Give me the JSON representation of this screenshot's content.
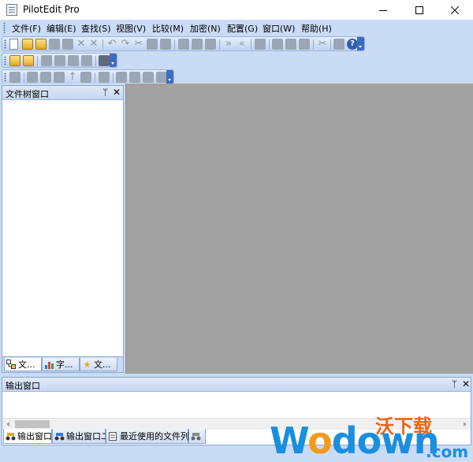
{
  "window": {
    "title": "PilotEdit Pro"
  },
  "menu": [
    "文件(F)",
    "编辑(E)",
    "查找(S)",
    "视图(V)",
    "比较(M)",
    "加密(N)",
    "配置(G)",
    "窗口(W)",
    "帮助(H)"
  ],
  "file_tree_panel": {
    "title": "文件树窗口",
    "pin": "ᛘ",
    "close": "✕",
    "tabs": [
      "文...",
      "字...",
      "文..."
    ]
  },
  "output_panel": {
    "title": "输出窗口",
    "pin": "ᛘ",
    "close": "✕",
    "tabs": [
      "输出窗口",
      "输出窗口二",
      "最近使用的文件列表"
    ]
  },
  "watermark": {
    "cn": "沃下载",
    "logo_w": "W",
    "logo_o": "o",
    "logo_rest": "down",
    "logo_com": ".com"
  },
  "colors": {
    "chrome": "#c9dbf5",
    "mdi_background": "#a2a2a2",
    "accent": "#3d6bc0"
  }
}
